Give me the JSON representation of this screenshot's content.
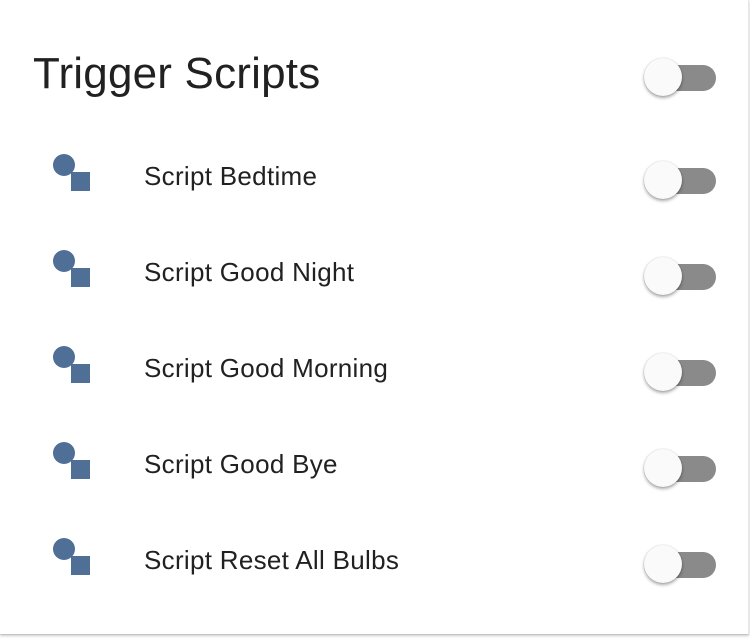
{
  "colors": {
    "icon": "#4f6f96",
    "toggle_track_off": "#8a8a8a",
    "toggle_thumb_off": "#fafafa",
    "title_text": "#212121"
  },
  "card": {
    "title": "Trigger Scripts",
    "master_toggle": {
      "state": "off"
    }
  },
  "rows": [
    {
      "label": "Script Bedtime",
      "icon": "script-shapes-icon",
      "toggle": "off"
    },
    {
      "label": "Script Good Night",
      "icon": "script-shapes-icon",
      "toggle": "off"
    },
    {
      "label": "Script Good Morning",
      "icon": "script-shapes-icon",
      "toggle": "off"
    },
    {
      "label": "Script Good Bye",
      "icon": "script-shapes-icon",
      "toggle": "off"
    },
    {
      "label": "Script Reset All Bulbs",
      "icon": "script-shapes-icon",
      "toggle": "off"
    }
  ]
}
